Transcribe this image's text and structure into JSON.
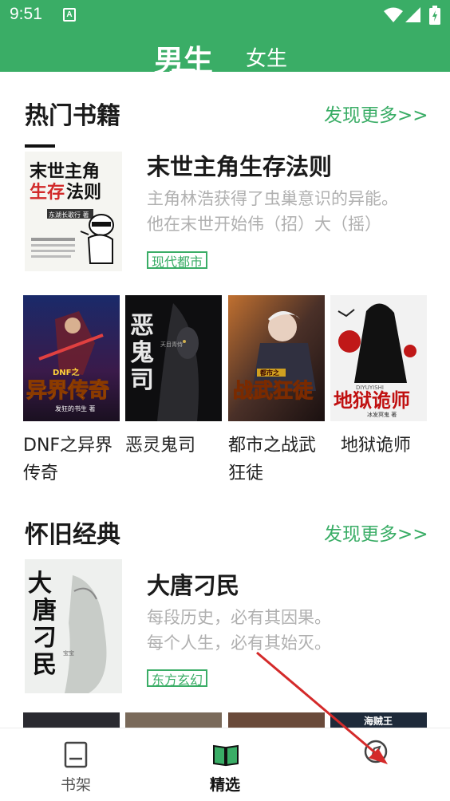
{
  "status_bar": {
    "time": "9:51",
    "sim_label": "A"
  },
  "header": {
    "tabs": [
      {
        "label": "男生",
        "active": true
      },
      {
        "label": "女生",
        "active": false
      }
    ],
    "color": "#3aad66"
  },
  "hot": {
    "title": "热门书籍",
    "more": "发现更多>>",
    "featured": {
      "title": "末世主角生存法则",
      "desc1": "主角林浩获得了虫巢意识的异能。",
      "desc2": "他在末世开始伟（招）大（摇）",
      "tag": "现代都市",
      "cover_text": "末世主角生存法则",
      "cover_author": "东湖长歌行 著"
    },
    "grid": [
      {
        "name": "DNF之异界传奇",
        "cover_text": "异界传奇",
        "cover_top": "DNF之",
        "cover_author": "发狂的书生 著"
      },
      {
        "name": "恶灵鬼司",
        "cover_text": "恶灵鬼司",
        "cover_author": "天目青侍"
      },
      {
        "name": "都市之战武狂徒",
        "cover_text": "战武狂徒",
        "cover_top": "都市之"
      },
      {
        "name": "地狱诡师",
        "cover_text": "地狱诡师",
        "cover_top": "DIYUYISHI",
        "cover_author": "冰发冥鬼 著"
      }
    ]
  },
  "classic": {
    "title": "怀旧经典",
    "more": "发现更多>>",
    "featured": {
      "title": "大唐刁民",
      "desc1": "每段历史，必有其因果。",
      "desc2": "每个人生，必有其始灭。",
      "tag": "东方玄幻",
      "cover_text": "大唐刁民",
      "cover_author": "宝宝"
    },
    "grid_partial": [
      {
        "cover_text": ""
      },
      {
        "cover_text": ""
      },
      {
        "cover_text": ""
      },
      {
        "cover_text": "海贼王"
      }
    ]
  },
  "bottom_nav": [
    {
      "label": "书架",
      "icon": "bookshelf-icon",
      "active": false
    },
    {
      "label": "精选",
      "icon": "open-book-icon",
      "active": true
    },
    {
      "label": "",
      "icon": "compass-icon",
      "active": false
    }
  ]
}
